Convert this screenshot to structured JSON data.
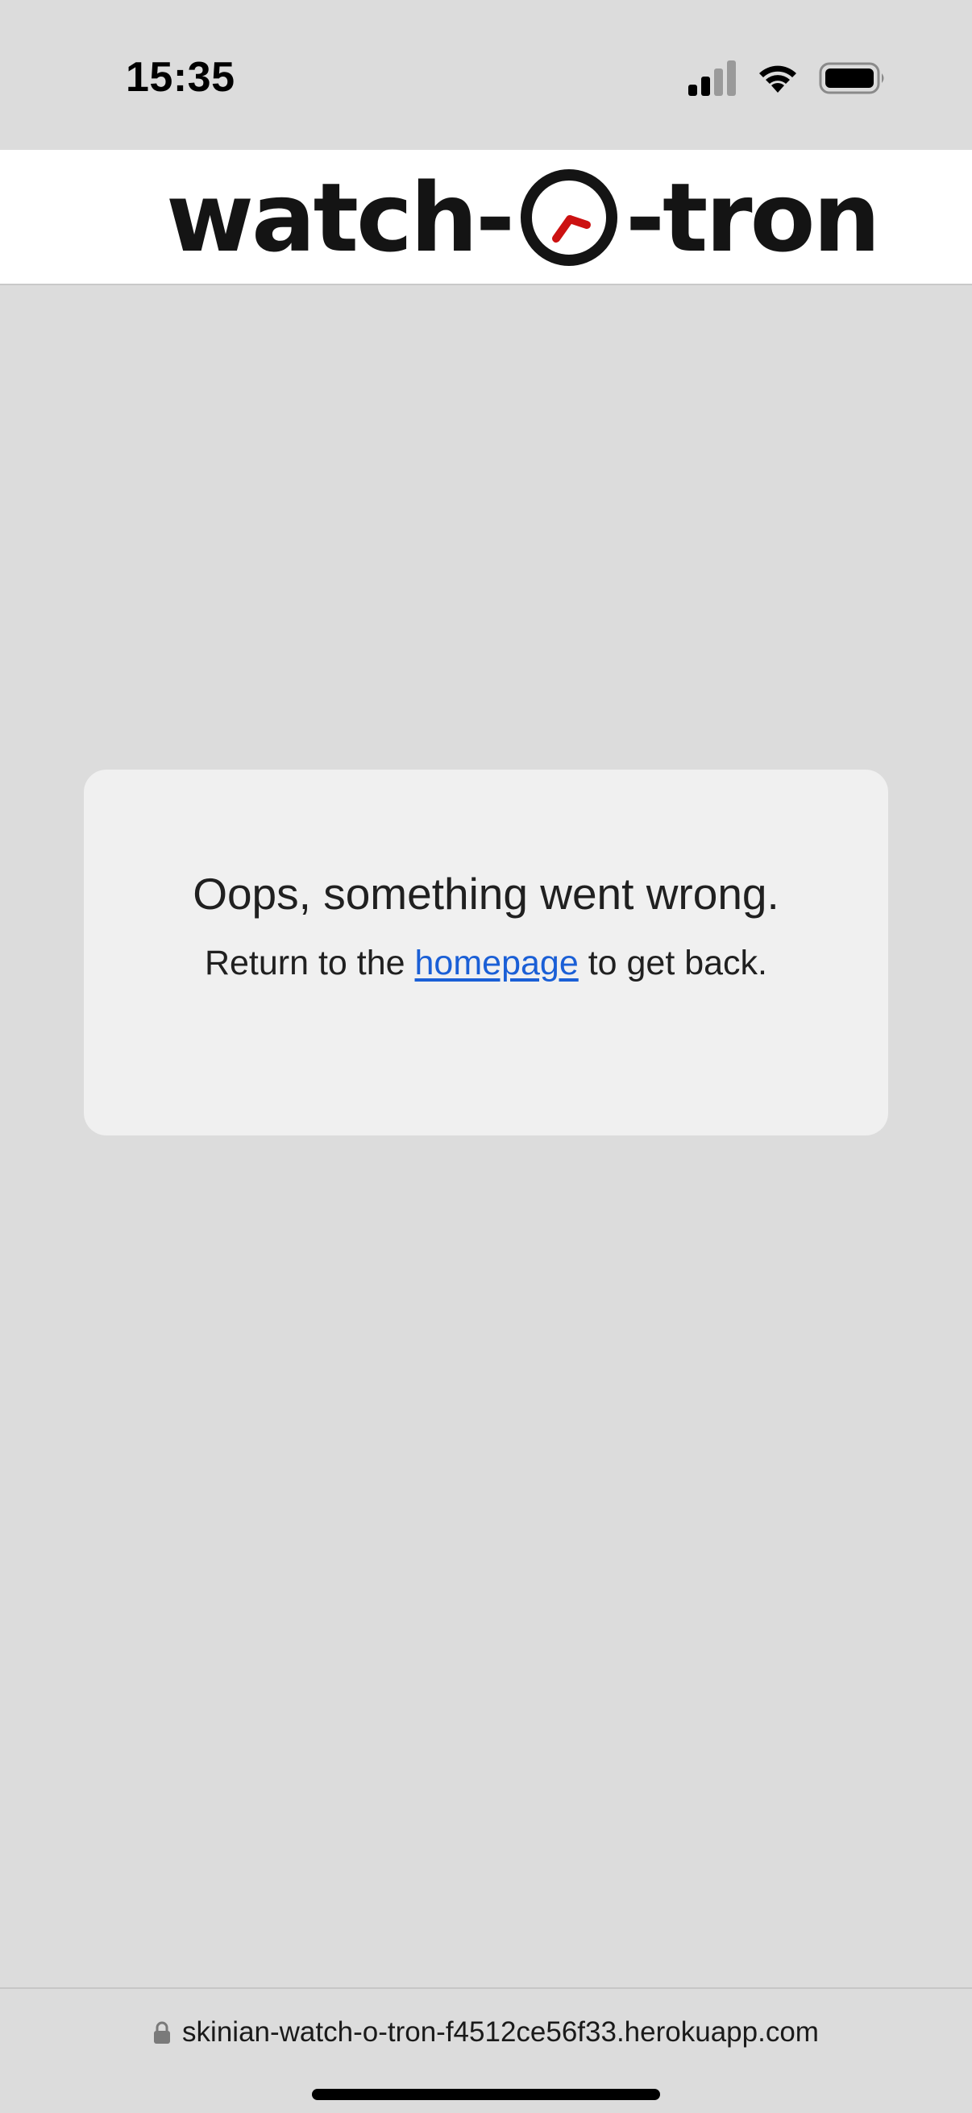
{
  "status_bar": {
    "time": "15:35",
    "icons": [
      "signal-icon",
      "wifi-icon",
      "battery-icon"
    ]
  },
  "header": {
    "logo_left": "watch-",
    "logo_right": "-tron",
    "logo_icon": "clock-icon",
    "colors": {
      "logo_text": "#141414",
      "clock_hand": "#cc1111"
    }
  },
  "error": {
    "heading": "Oops, something went wrong.",
    "message_before": "Return to the ",
    "link_label": "homepage",
    "message_after": " to get back.",
    "colors": {
      "link": "#1a5fd6",
      "card_background": "#f0f0f0",
      "page_background": "#dcdcdc"
    }
  },
  "browser": {
    "url": "skinian-watch-o-tron-f4512ce56f33.herokuapp.com",
    "lock_icon": "lock-icon"
  }
}
